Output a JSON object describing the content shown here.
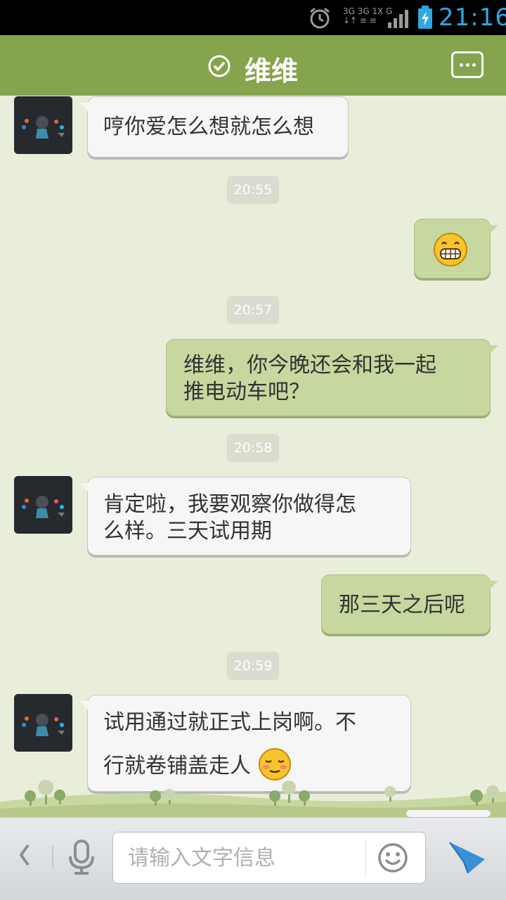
{
  "status_bar": {
    "time": "21:16",
    "network_line1": "3G 3G 1X G",
    "network_line2": "↓↑ ≡ ≡ ",
    "icons": [
      "alarm-icon",
      "signal-icon",
      "battery-charging-icon"
    ]
  },
  "header": {
    "title": "维维",
    "status_icon": "check-circle-icon",
    "menu_icon": "chat-menu-icon"
  },
  "messages": [
    {
      "side": "left",
      "text": "哼你爱怎么想就怎么想"
    },
    {
      "timestamp": "20:55"
    },
    {
      "side": "right",
      "emoji": "grin-emoji"
    },
    {
      "timestamp": "20:57"
    },
    {
      "side": "right",
      "lines": [
        "维维，你今晚还会和我一起",
        "推电动车吧？"
      ]
    },
    {
      "timestamp": "20:58"
    },
    {
      "side": "left",
      "lines": [
        "肯定啦，我要观察你做得怎",
        "么样。三天试用期"
      ]
    },
    {
      "side": "right",
      "text": "那三天之后呢"
    },
    {
      "timestamp": "20:59"
    },
    {
      "side": "left",
      "lines": [
        "试用通过就正式上岗啊。不",
        "行就卷铺盖走人"
      ],
      "emoji": "shy-smile-emoji"
    }
  ],
  "input_bar": {
    "placeholder": "请输入文字信息",
    "value": "",
    "icons": [
      "back-arrow-icon",
      "microphone-icon",
      "emoji-smile-icon",
      "send-icon"
    ]
  },
  "colors": {
    "header": "#86a34d",
    "background": "#e9eedb",
    "bubble_left": "#f6f6f6",
    "bubble_right": "#c7d7a0",
    "status_time": "#2fa7e0"
  }
}
